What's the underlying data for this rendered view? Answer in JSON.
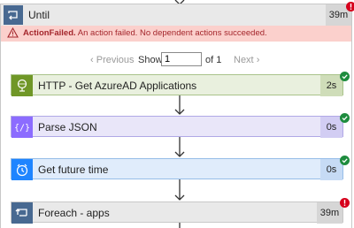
{
  "until": {
    "title": "Until",
    "duration": "39m"
  },
  "error": {
    "label": "ActionFailed.",
    "message": " An action failed. No dependent actions succeeded."
  },
  "pager": {
    "previous": "Previous",
    "show": "Show",
    "page_value": "1",
    "of": "of 1",
    "next": "Next"
  },
  "actions": [
    {
      "title": "HTTP - Get AzureAD Applications",
      "duration": "2s",
      "status": "success"
    },
    {
      "title": "Parse JSON",
      "duration": "0s",
      "status": "success"
    },
    {
      "title": "Get future time",
      "duration": "0s",
      "status": "success"
    },
    {
      "title": "Foreach - apps",
      "duration": "39m",
      "status": "failed"
    }
  ],
  "colors": {
    "http": "#709727",
    "parse": "#8c6cff",
    "time": "#1f85ff",
    "control": "#486991",
    "success": "#1e8c3e",
    "error": "#d6001c",
    "error_bg": "#fbd0cc"
  }
}
